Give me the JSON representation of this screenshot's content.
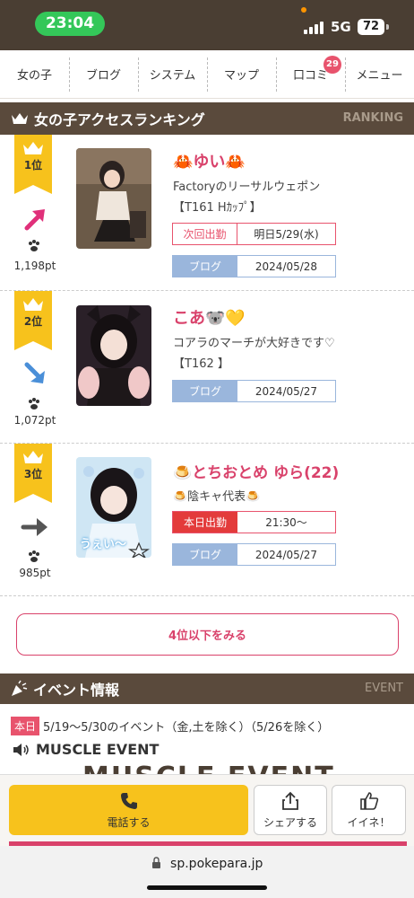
{
  "status": {
    "time": "23:04",
    "network": "5G",
    "battery": "72"
  },
  "nav": {
    "items": [
      "女の子",
      "ブログ",
      "システム",
      "マップ",
      "口コミ",
      "メニュー"
    ],
    "review_badge": "29"
  },
  "ranking": {
    "title": "女の子アクセスランキング",
    "title_en": "RANKING",
    "more_label": "4位以下をみる",
    "entries": [
      {
        "rank": "1位",
        "points": "1,198pt",
        "trend": "up",
        "name": "🦀ゆい🦀",
        "catch": "Factoryのリーサルウェポン",
        "spec": "【T161 Hｶｯﾌﾟ】",
        "schedule_label": "次回出勤",
        "schedule_value": "明日5/29(水)",
        "blog_label": "ブログ",
        "blog_date": "2024/05/28"
      },
      {
        "rank": "2位",
        "points": "1,072pt",
        "trend": "down",
        "name": "こあ🐨💛",
        "catch": "コアラのマーチが大好きです♡",
        "spec": "【T162 】",
        "blog_label": "ブログ",
        "blog_date": "2024/05/27"
      },
      {
        "rank": "3位",
        "points": "985pt",
        "trend": "flat",
        "name": "🍮とちおとめ ゆら(22)",
        "catch": "🍮陰キャ代表🍮",
        "schedule_label": "本日出勤",
        "schedule_value": "21:30〜",
        "blog_label": "ブログ",
        "blog_date": "2024/05/27",
        "photo_caption": "うぇい〜"
      }
    ]
  },
  "event": {
    "title": "イベント情報",
    "title_en": "EVENT",
    "today_tag": "本日",
    "period": "5/19〜5/30のイベント（金,土を除く）（5/26を除く）",
    "name": "MUSCLE EVENT",
    "banner_text": "MUSCLE EVENT"
  },
  "bottom": {
    "call": "電話する",
    "share": "シェアする",
    "like": "イイネ！"
  },
  "browser": {
    "url": "sp.pokepara.jp"
  },
  "colors": {
    "accent_pink": "#d9426b",
    "header_brown": "#5a4a3c",
    "rank_gold": "#f7c21c",
    "blog_blue": "#9ab6dc"
  }
}
